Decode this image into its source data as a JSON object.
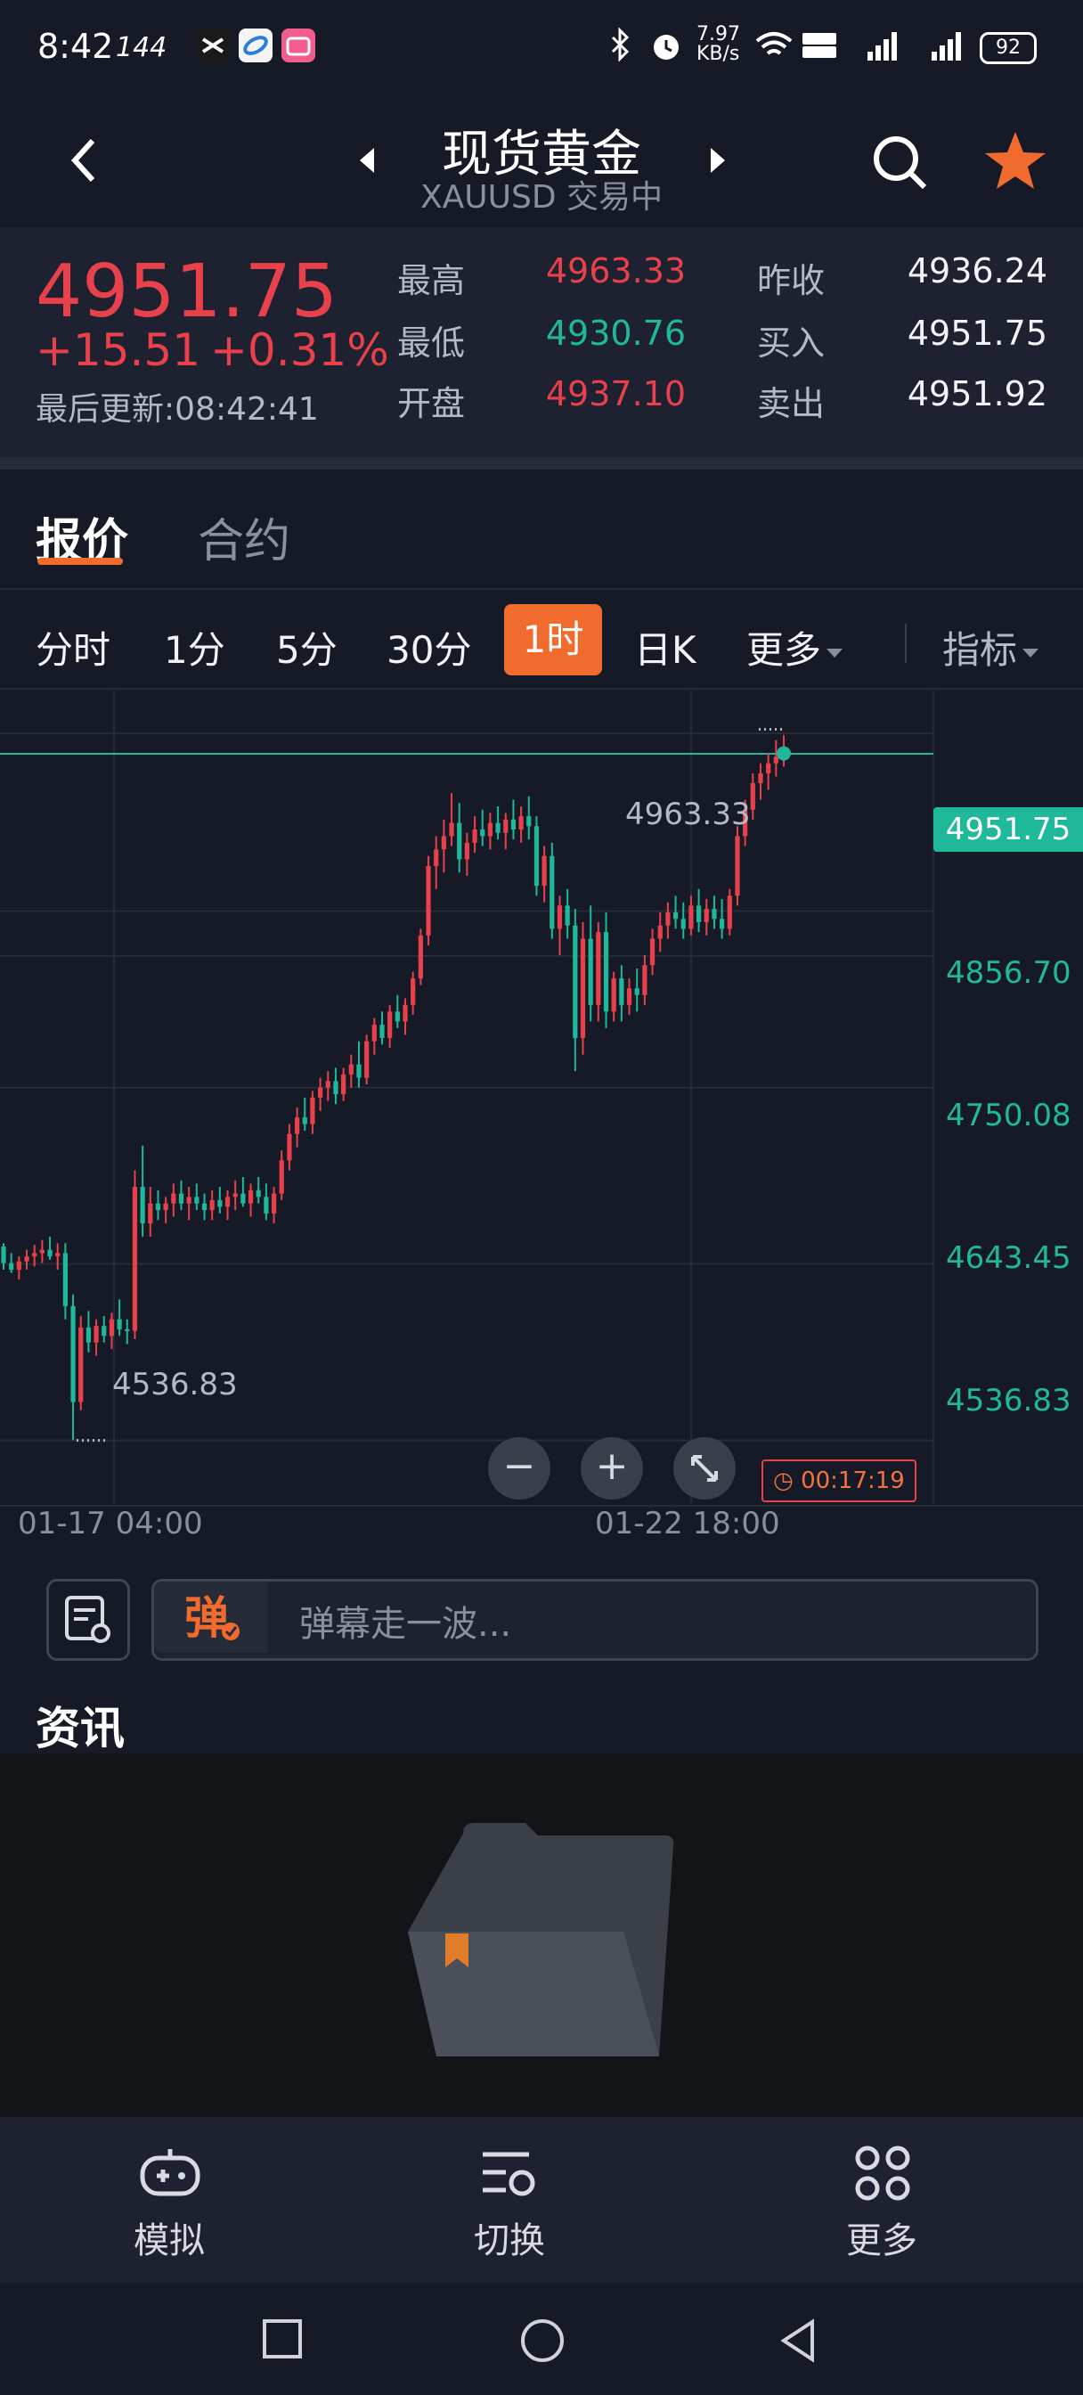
{
  "status_bar": {
    "time": "8:42",
    "hz": "144",
    "net_speed": "7.97 KB/s",
    "battery": "92"
  },
  "header": {
    "title": "现货黄金",
    "subtitle": "XAUUSD 交易中"
  },
  "quote": {
    "price": "4951.75",
    "change": "+15.51",
    "change_pct": "+0.31%",
    "updated": "最后更新:08:42:41",
    "high_label": "最高",
    "high": "4963.33",
    "low_label": "最低",
    "low": "4930.76",
    "open_label": "开盘",
    "open": "4937.10",
    "prev_close_label": "昨收",
    "prev_close": "4936.24",
    "bid_label": "买入",
    "bid": "4951.75",
    "ask_label": "卖出",
    "ask": "4951.92"
  },
  "tabs": {
    "quote": "报价",
    "contract": "合约"
  },
  "intervals": {
    "fenshi": "分时",
    "m1": "1分",
    "m5": "5分",
    "m30": "30分",
    "h1": "1时",
    "day": "日K",
    "more": "更多",
    "indicators": "指标"
  },
  "chart_data": {
    "type": "candlestick",
    "interval": "1时",
    "y_axis_labels": [
      "4856.70",
      "4750.08",
      "4643.45",
      "4536.83"
    ],
    "current_price_tag": "4951.75",
    "max_marker": "4963.33",
    "min_marker": "4536.83",
    "x_labels": [
      "01-17 04:00",
      "01-22 18:00"
    ],
    "ylim": [
      4500,
      4990
    ],
    "candles": [
      [
        4654,
        4656,
        4640,
        4644
      ],
      [
        4644,
        4650,
        4638,
        4640
      ],
      [
        4640,
        4648,
        4634,
        4645
      ],
      [
        4645,
        4652,
        4640,
        4648
      ],
      [
        4648,
        4655,
        4642,
        4650
      ],
      [
        4650,
        4658,
        4644,
        4652
      ],
      [
        4652,
        4660,
        4646,
        4648
      ],
      [
        4648,
        4656,
        4640,
        4650
      ],
      [
        4650,
        4656,
        4610,
        4618
      ],
      [
        4618,
        4625,
        4537,
        4560
      ],
      [
        4560,
        4612,
        4555,
        4605
      ],
      [
        4605,
        4615,
        4590,
        4596
      ],
      [
        4596,
        4610,
        4588,
        4606
      ],
      [
        4606,
        4612,
        4596,
        4600
      ],
      [
        4600,
        4614,
        4592,
        4610
      ],
      [
        4610,
        4622,
        4600,
        4604
      ],
      [
        4604,
        4610,
        4595,
        4603
      ],
      [
        4603,
        4700,
        4598,
        4690
      ],
      [
        4690,
        4715,
        4660,
        4668
      ],
      [
        4668,
        4690,
        4660,
        4680
      ],
      [
        4680,
        4688,
        4670,
        4676
      ],
      [
        4676,
        4684,
        4668,
        4680
      ],
      [
        4680,
        4692,
        4672,
        4686
      ],
      [
        4686,
        4694,
        4676,
        4680
      ],
      [
        4680,
        4690,
        4670,
        4684
      ],
      [
        4684,
        4692,
        4676,
        4680
      ],
      [
        4680,
        4686,
        4670,
        4676
      ],
      [
        4676,
        4688,
        4670,
        4682
      ],
      [
        4682,
        4690,
        4674,
        4678
      ],
      [
        4678,
        4688,
        4670,
        4684
      ],
      [
        4684,
        4694,
        4676,
        4686
      ],
      [
        4686,
        4696,
        4678,
        4680
      ],
      [
        4680,
        4692,
        4672,
        4688
      ],
      [
        4688,
        4696,
        4680,
        4684
      ],
      [
        4684,
        4692,
        4670,
        4674
      ],
      [
        4674,
        4690,
        4668,
        4686
      ],
      [
        4686,
        4712,
        4682,
        4706
      ],
      [
        4706,
        4728,
        4700,
        4722
      ],
      [
        4722,
        4738,
        4714,
        4732
      ],
      [
        4732,
        4744,
        4724,
        4728
      ],
      [
        4728,
        4748,
        4722,
        4744
      ],
      [
        4744,
        4756,
        4736,
        4750
      ],
      [
        4750,
        4760,
        4742,
        4754
      ],
      [
        4754,
        4762,
        4740,
        4746
      ],
      [
        4746,
        4762,
        4742,
        4758
      ],
      [
        4758,
        4770,
        4750,
        4764
      ],
      [
        4764,
        4778,
        4750,
        4756
      ],
      [
        4756,
        4782,
        4752,
        4778
      ],
      [
        4778,
        4792,
        4770,
        4788
      ],
      [
        4788,
        4796,
        4776,
        4780
      ],
      [
        4780,
        4800,
        4774,
        4796
      ],
      [
        4796,
        4806,
        4786,
        4790
      ],
      [
        4790,
        4804,
        4782,
        4800
      ],
      [
        4800,
        4820,
        4794,
        4816
      ],
      [
        4816,
        4846,
        4812,
        4842
      ],
      [
        4842,
        4890,
        4836,
        4884
      ],
      [
        4884,
        4902,
        4870,
        4894
      ],
      [
        4894,
        4912,
        4880,
        4902
      ],
      [
        4902,
        4928,
        4896,
        4910
      ],
      [
        4910,
        4922,
        4880,
        4888
      ],
      [
        4888,
        4904,
        4878,
        4898
      ],
      [
        4898,
        4914,
        4892,
        4906
      ],
      [
        4906,
        4918,
        4896,
        4902
      ],
      [
        4902,
        4916,
        4894,
        4910
      ],
      [
        4910,
        4920,
        4900,
        4904
      ],
      [
        4904,
        4916,
        4894,
        4912
      ],
      [
        4912,
        4924,
        4900,
        4906
      ],
      [
        4906,
        4920,
        4898,
        4914
      ],
      [
        4914,
        4926,
        4900,
        4908
      ],
      [
        4908,
        4914,
        4866,
        4872
      ],
      [
        4872,
        4896,
        4862,
        4890
      ],
      [
        4890,
        4898,
        4840,
        4846
      ],
      [
        4846,
        4866,
        4830,
        4860
      ],
      [
        4860,
        4870,
        4840,
        4848
      ],
      [
        4848,
        4858,
        4760,
        4780
      ],
      [
        4780,
        4850,
        4770,
        4840
      ],
      [
        4840,
        4860,
        4790,
        4800
      ],
      [
        4800,
        4850,
        4790,
        4844
      ],
      [
        4844,
        4856,
        4786,
        4796
      ],
      [
        4796,
        4820,
        4790,
        4816
      ],
      [
        4816,
        4824,
        4790,
        4800
      ],
      [
        4800,
        4816,
        4794,
        4810
      ],
      [
        4810,
        4822,
        4796,
        4806
      ],
      [
        4806,
        4830,
        4800,
        4824
      ],
      [
        4824,
        4846,
        4818,
        4840
      ],
      [
        4840,
        4856,
        4832,
        4848
      ],
      [
        4848,
        4862,
        4840,
        4856
      ],
      [
        4856,
        4866,
        4846,
        4852
      ],
      [
        4852,
        4862,
        4840,
        4846
      ],
      [
        4846,
        4866,
        4842,
        4860
      ],
      [
        4860,
        4870,
        4844,
        4850
      ],
      [
        4850,
        4864,
        4842,
        4858
      ],
      [
        4858,
        4866,
        4846,
        4852
      ],
      [
        4852,
        4864,
        4840,
        4846
      ],
      [
        4846,
        4870,
        4842,
        4866
      ],
      [
        4866,
        4908,
        4860,
        4902
      ],
      [
        4902,
        4924,
        4896,
        4918
      ],
      [
        4918,
        4940,
        4912,
        4934
      ],
      [
        4934,
        4946,
        4924,
        4940
      ],
      [
        4940,
        4952,
        4930,
        4946
      ],
      [
        4946,
        4960,
        4938,
        4950
      ],
      [
        4950,
        4963,
        4944,
        4952
      ]
    ]
  },
  "chart_controls": {
    "zoom_out": "−",
    "zoom_in": "+",
    "timer": "00:17:19"
  },
  "danmu": {
    "placeholder": "弹幕走一波..."
  },
  "news": {
    "title": "资讯"
  },
  "bottom_nav": {
    "simulate": "模拟",
    "switch": "切换",
    "more": "更多"
  },
  "colors": {
    "up": "#e8414c",
    "down": "#1fb89a",
    "accent": "#f26b2e"
  }
}
